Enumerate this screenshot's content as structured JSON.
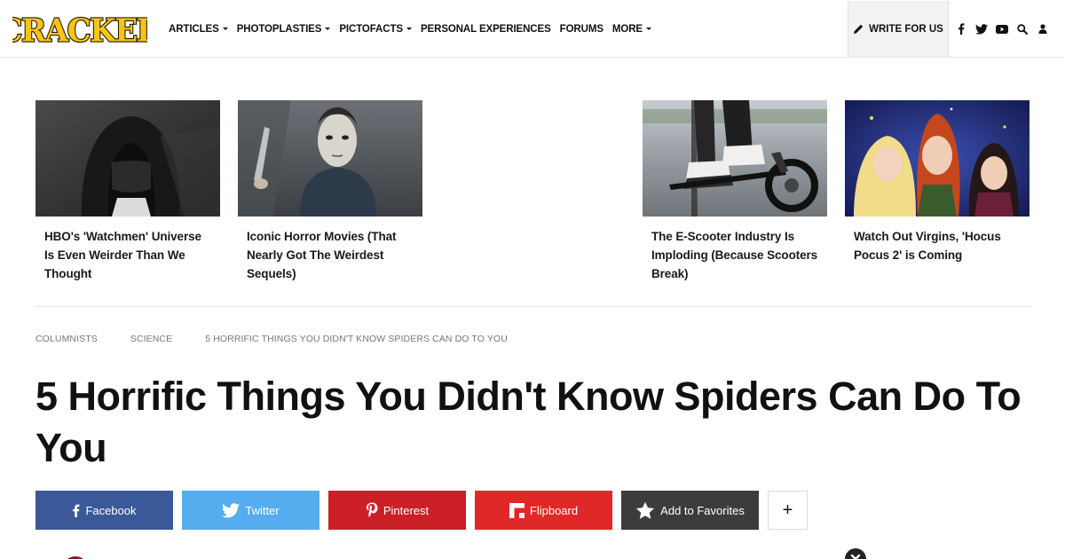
{
  "header": {
    "logo_text": "CRACKED",
    "nav": [
      {
        "label": "ARTICLES",
        "dropdown": true
      },
      {
        "label": "PHOTOPLASTIES",
        "dropdown": true
      },
      {
        "label": "PICTOFACTS",
        "dropdown": true
      },
      {
        "label": "PERSONAL EXPERIENCES",
        "dropdown": false
      },
      {
        "label": "FORUMS",
        "dropdown": false
      },
      {
        "label": "MORE",
        "dropdown": true
      }
    ],
    "write_for_us": "WRITE FOR US",
    "icons": [
      "facebook-icon",
      "twitter-icon",
      "youtube-icon",
      "search-icon",
      "user-icon"
    ]
  },
  "trending": [
    {
      "title": "HBO's 'Watchmen' Universe Is Even Weirder Than We Thought"
    },
    {
      "title": "Iconic Horror Movies (That Nearly Got The Weirdest Sequels)"
    },
    {
      "title": "The E-Scooter Industry Is Imploding (Because Scooters Break)"
    },
    {
      "title": "Watch Out Virgins, 'Hocus Pocus 2' is Coming"
    }
  ],
  "breadcrumb": [
    "COLUMNISTS",
    "SCIENCE",
    "5 HORRIFIC THINGS YOU DIDN'T KNOW SPIDERS CAN DO TO YOU"
  ],
  "article": {
    "title": "5 Horrific Things You Didn't Know Spiders Can Do To You"
  },
  "share": {
    "facebook": "Facebook",
    "twitter": "Twitter",
    "pinterest": "Pinterest",
    "flipboard": "Flipboard",
    "favorites": "Add to Favorites",
    "more": "+"
  },
  "colors": {
    "logo_yellow": "#f5c518",
    "facebook": "#3b5998",
    "twitter": "#55acee",
    "pinterest": "#cb2027",
    "flipboard": "#e12828",
    "favorites": "#3c3c3c"
  }
}
